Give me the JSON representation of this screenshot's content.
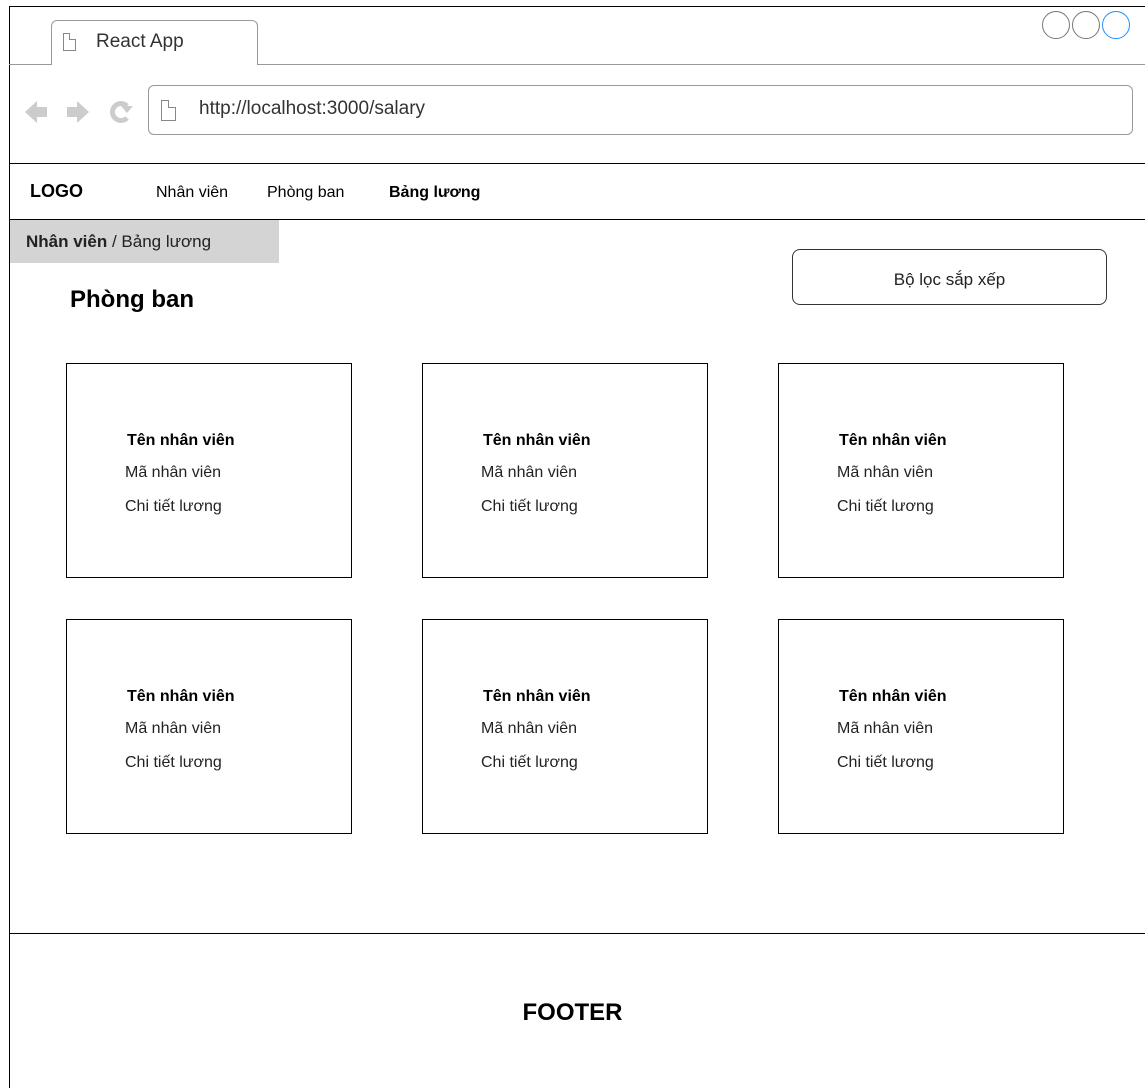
{
  "browser": {
    "tab_title": "React App",
    "url": "http://localhost:3000/salary"
  },
  "header": {
    "logo": "LOGO",
    "menu": [
      "Nhân viên",
      "Phòng ban",
      "Bảng lương"
    ],
    "active_menu": "Bảng lương"
  },
  "breadcrumb": {
    "first": "Nhân viên",
    "separator": " / ",
    "current": "Bảng lương"
  },
  "main": {
    "title": "Phòng ban",
    "filter_label": "Bộ lọc sắp xếp",
    "cards": [
      {
        "name": "Tên nhân viên",
        "code": "Mã nhân viên",
        "detail": "Chi tiết lương"
      },
      {
        "name": "Tên nhân viên",
        "code": "Mã nhân viên",
        "detail": "Chi tiết lương"
      },
      {
        "name": "Tên nhân viên",
        "code": "Mã nhân viên",
        "detail": "Chi tiết lương"
      },
      {
        "name": "Tên nhân viên",
        "code": "Mã nhân viên",
        "detail": "Chi tiết lương"
      },
      {
        "name": "Tên nhân viên",
        "code": "Mã nhân viên",
        "detail": "Chi tiết lương"
      },
      {
        "name": "Tên nhân viên",
        "code": "Mã nhân viên",
        "detail": "Chi tiết lương"
      }
    ]
  },
  "footer": {
    "text": "FOOTER"
  },
  "icons": {
    "tab": "page-icon",
    "back": "back-arrow-icon",
    "forward": "forward-arrow-icon",
    "reload": "reload-icon",
    "url": "page-icon"
  },
  "colors": {
    "breadcrumb_bg": "#d4d4d4",
    "window_control_accent": "#1e90ff"
  }
}
